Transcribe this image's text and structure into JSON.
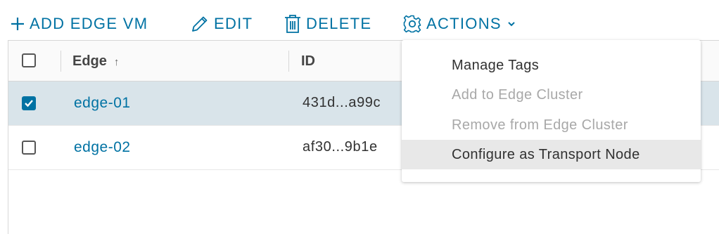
{
  "toolbar": {
    "add_label": "ADD EDGE VM",
    "edit_label": "EDIT",
    "delete_label": "DELETE",
    "actions_label": "ACTIONS"
  },
  "table": {
    "columns": [
      "Edge",
      "ID"
    ],
    "rows": [
      {
        "name": "edge-01",
        "id": "431d...a99c",
        "checked": true
      },
      {
        "name": "edge-02",
        "id": "af30...9b1e",
        "checked": false
      }
    ]
  },
  "actions_menu": {
    "items": [
      {
        "label": "Manage Tags",
        "enabled": true
      },
      {
        "label": "Add to Edge Cluster",
        "enabled": false
      },
      {
        "label": "Remove from Edge Cluster",
        "enabled": false
      },
      {
        "label": "Configure as Transport Node",
        "enabled": true,
        "hovered": true
      }
    ]
  },
  "colors": {
    "accent": "#0072a3",
    "selected_row": "#d9e4ea",
    "disabled_text": "#a8a8a8"
  }
}
